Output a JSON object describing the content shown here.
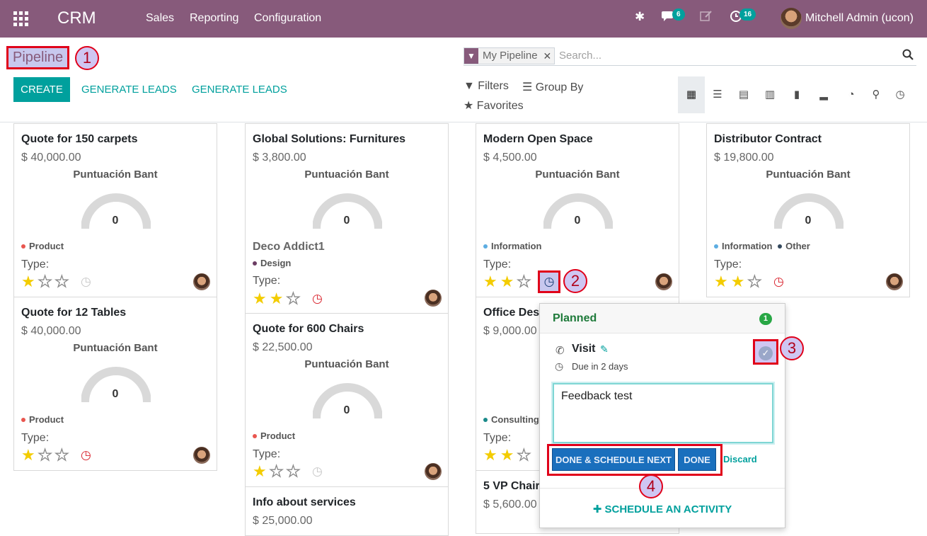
{
  "nav": {
    "app_name": "CRM",
    "menu": [
      "Sales",
      "Reporting",
      "Configuration"
    ],
    "messages_count": "6",
    "activities_count": "16",
    "user": "Mitchell Admin (ucon)"
  },
  "control": {
    "breadcrumb": "Pipeline",
    "create_label": "CREATE",
    "generate_leads_1": "GENERATE LEADS",
    "generate_leads_2": "GENERATE LEADS",
    "facet_label": "My Pipeline",
    "search_placeholder": "Search...",
    "filters": "Filters",
    "group_by": "Group By",
    "favorites": "Favorites"
  },
  "markers": [
    "1",
    "2",
    "3",
    "4"
  ],
  "cards": {
    "c1": {
      "title": "Quote for 150 carpets",
      "amount": "$ 40,000.00",
      "gauge_label": "Puntuación Bant",
      "gauge_value": "0",
      "tag": "Product",
      "type_label": "Type:"
    },
    "c2": {
      "title": "Quote for 12 Tables",
      "amount": "$ 40,000.00",
      "gauge_label": "Puntuación Bant",
      "gauge_value": "0",
      "tag": "Product",
      "type_label": "Type:"
    },
    "c3": {
      "title": "Global Solutions: Furnitures",
      "amount": "$ 3,800.00",
      "gauge_label": "Puntuación Bant",
      "gauge_value": "0",
      "subtitle": "Deco Addict1",
      "tag": "Design",
      "type_label": "Type:"
    },
    "c4": {
      "title": "Quote for 600 Chairs",
      "amount": "$ 22,500.00",
      "gauge_label": "Puntuación Bant",
      "gauge_value": "0",
      "tag": "Product",
      "type_label": "Type:"
    },
    "c5": {
      "title": "Info about services",
      "amount": "$ 25,000.00"
    },
    "c6": {
      "title": "Modern Open Space",
      "amount": "$ 4,500.00",
      "gauge_label": "Puntuación Bant",
      "gauge_value": "0",
      "tag": "Information",
      "type_label": "Type:"
    },
    "c7": {
      "title": "Office Design",
      "amount": "$ 9,000.00",
      "tag": "Consulting",
      "type_label": "Type:"
    },
    "c8": {
      "title": "5 VP Chairs",
      "amount": "$ 5,600.00"
    },
    "c9": {
      "title": "Distributor Contract",
      "amount": "$ 19,800.00",
      "gauge_label": "Puntuación Bant",
      "gauge_value": "0",
      "tag": "Information",
      "tag2": "Other",
      "type_label": "Type:"
    }
  },
  "popover": {
    "header": "Planned",
    "count": "1",
    "activity": "Visit",
    "due": "Due in 2 days",
    "feedback": "Feedback test",
    "done_schedule_next": "DONE & SCHEDULE NEXT",
    "done": "DONE",
    "discard": "Discard",
    "schedule": "SCHEDULE AN ACTIVITY"
  },
  "colors": {
    "brand": "#875a7b",
    "accent": "#00a09d",
    "tag_product": "#e9564f",
    "tag_design": "#6b3d63",
    "tag_info": "#5dade2",
    "tag_other": "#34495e",
    "tag_consulting": "#1a8a8a"
  }
}
